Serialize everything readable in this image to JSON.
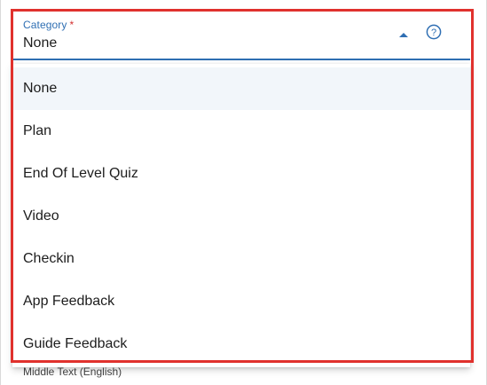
{
  "field": {
    "label": "Category",
    "required_marker": "*",
    "value": "None",
    "help_symbol": "?"
  },
  "menu": {
    "options": [
      "None",
      "Plan",
      "End Of Level Quiz",
      "Video",
      "Checkin",
      "App Feedback",
      "Guide Feedback"
    ],
    "selected": "None"
  },
  "next_field_label": "Middle Text (English)",
  "colors": {
    "accent": "#2f6fb3",
    "required": "#d32f2f",
    "highlight": "#e0312d",
    "selected_row": "#f2f6fa"
  },
  "icons": {
    "dropdown": "caret-up-icon",
    "help": "help-circle-icon"
  }
}
